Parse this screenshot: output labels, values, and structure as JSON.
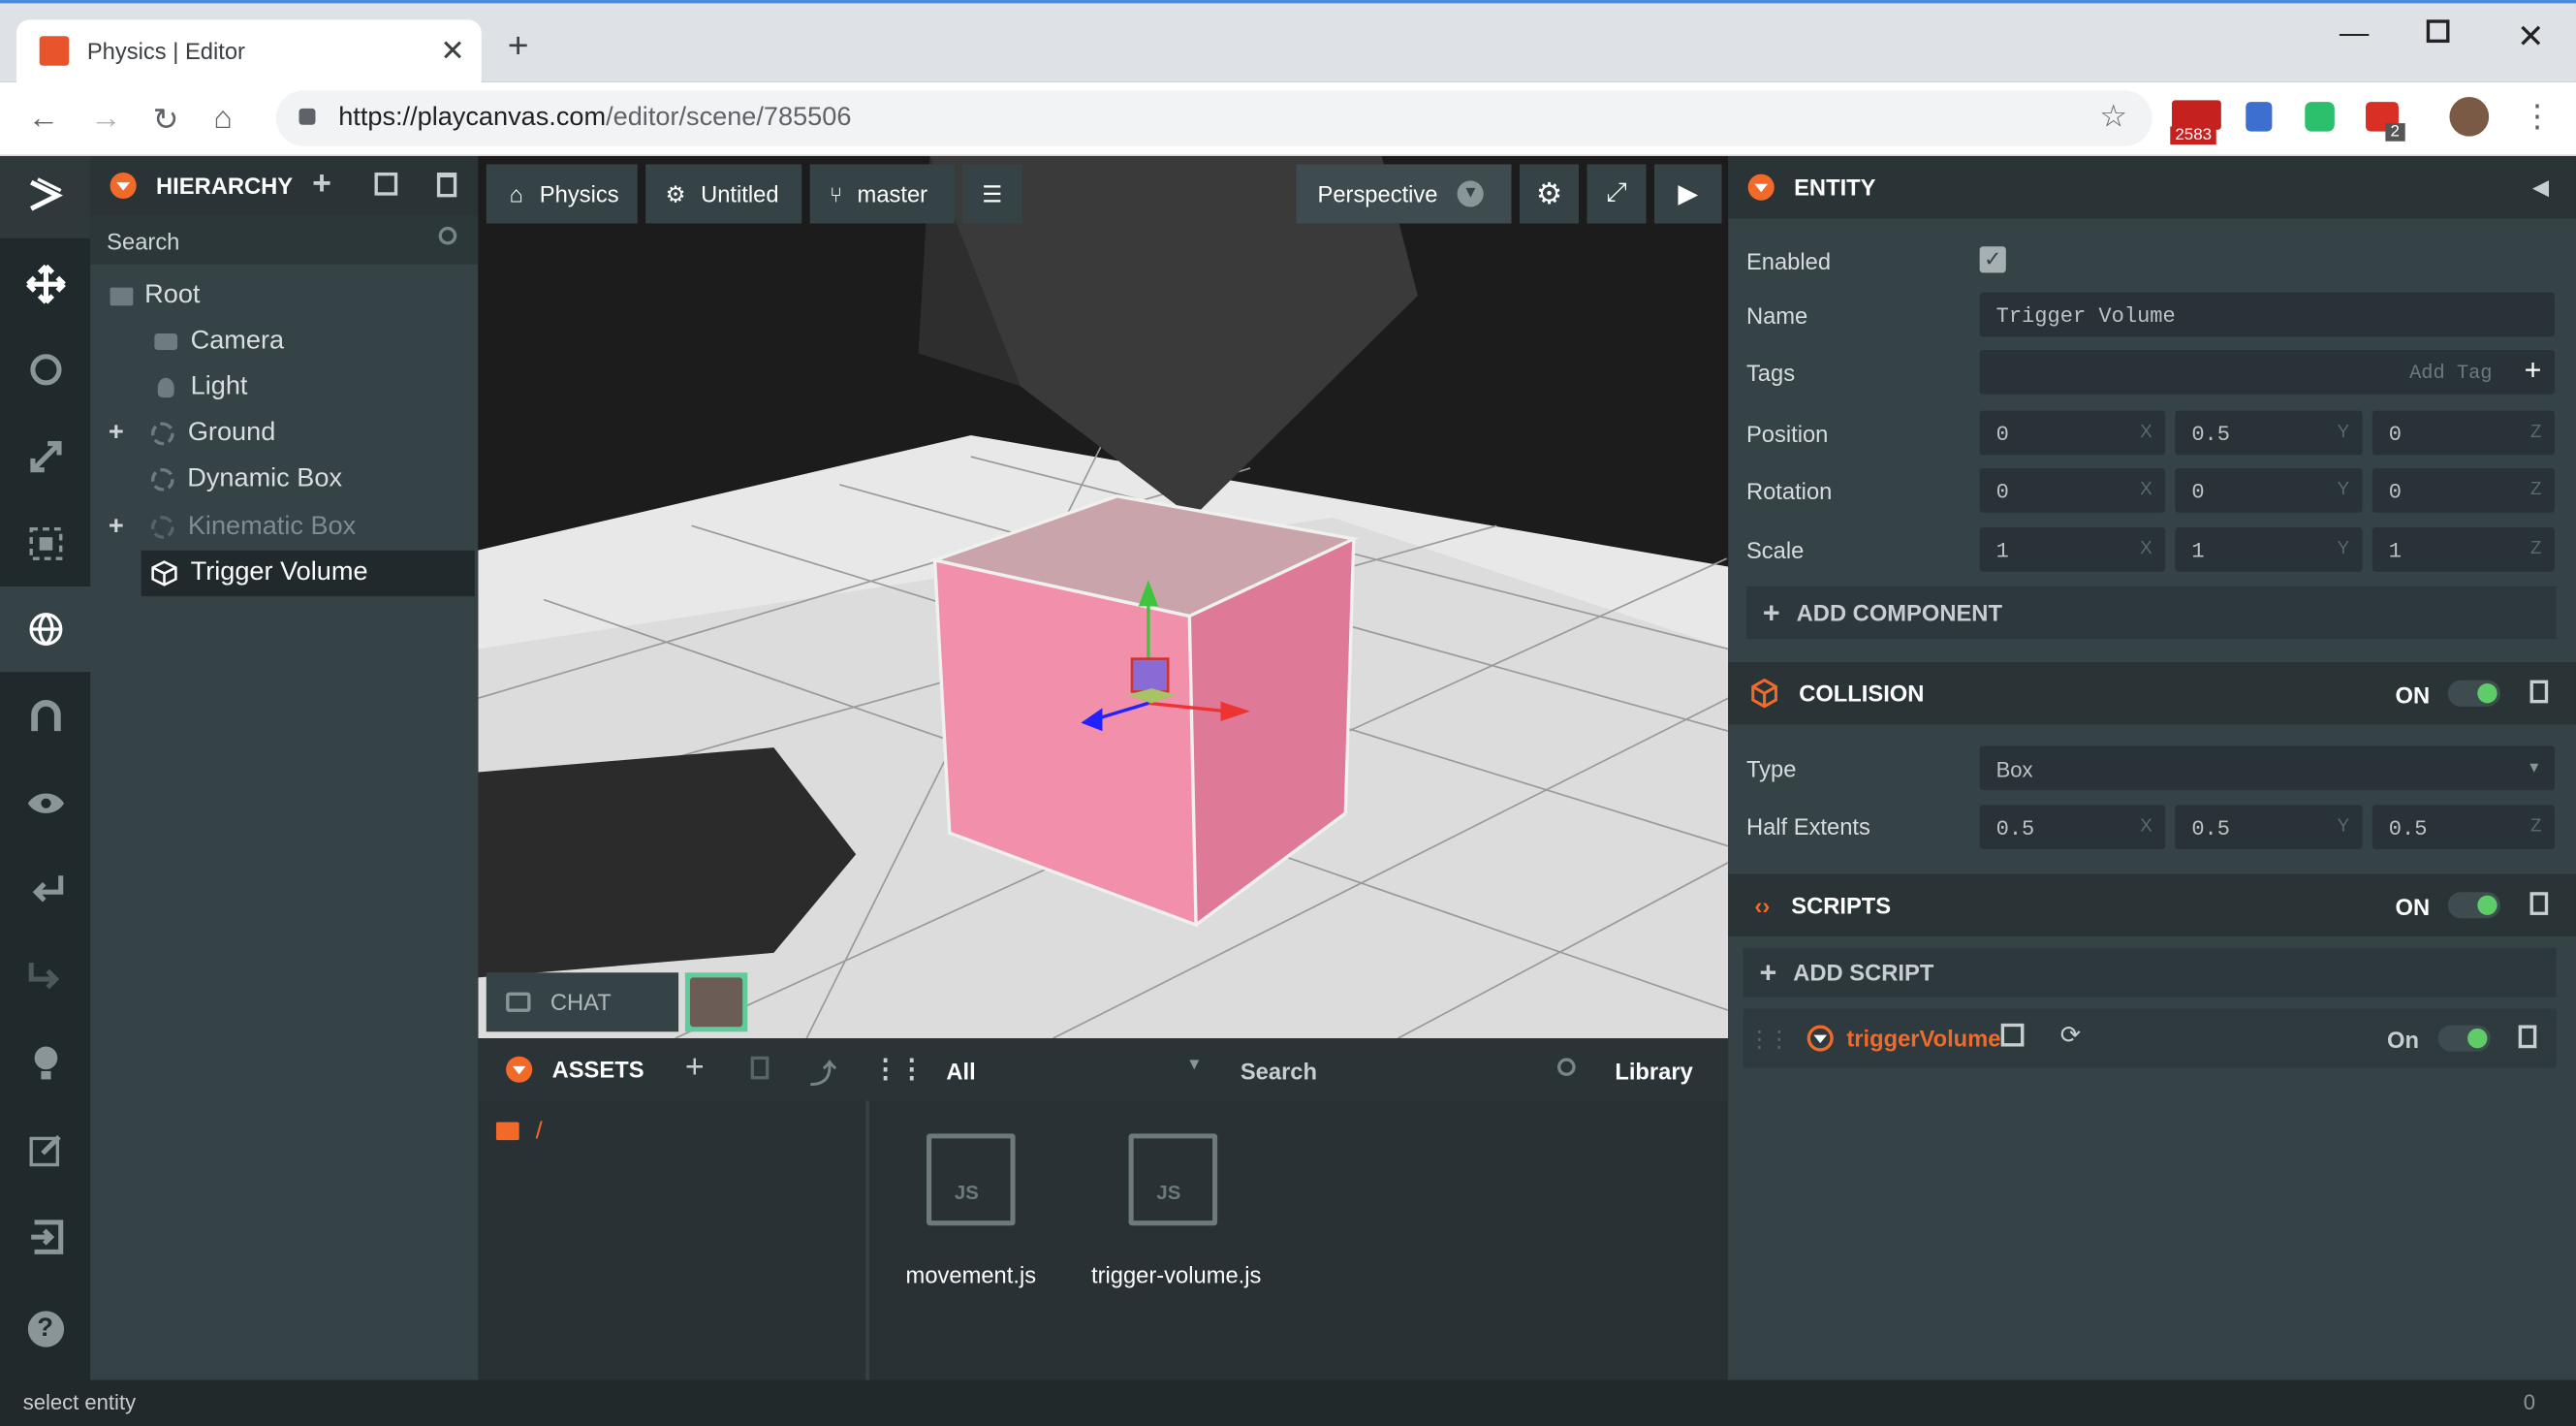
{
  "browser": {
    "tab_title": "Physics | Editor",
    "url_host": "https://playcanvas.com",
    "url_path": "/editor/scene/785506",
    "badge_mail": "2583",
    "badge_ext": "2"
  },
  "hierarchy": {
    "title": "HIERARCHY",
    "search_placeholder": "Search",
    "items": [
      {
        "label": "Root",
        "icon": "folder-icon"
      },
      {
        "label": "Camera",
        "icon": "camera-icon"
      },
      {
        "label": "Light",
        "icon": "light-icon"
      },
      {
        "label": "Ground",
        "icon": "entity-icon"
      },
      {
        "label": "Dynamic Box",
        "icon": "entity-icon"
      },
      {
        "label": "Kinematic Box",
        "icon": "entity-icon"
      },
      {
        "label": "Trigger Volume",
        "icon": "cube-icon"
      }
    ]
  },
  "viewport": {
    "project": "Physics",
    "scene": "Untitled",
    "branch": "master",
    "camera": "Perspective",
    "chat": "CHAT"
  },
  "assets": {
    "title": "ASSETS",
    "filter": "All",
    "search_placeholder": "Search",
    "library": "Library",
    "folder": "/",
    "files": [
      {
        "name": "movement.js",
        "ext": "JS"
      },
      {
        "name": "trigger-volume.js",
        "ext": "JS"
      }
    ]
  },
  "inspector": {
    "title": "ENTITY",
    "enabled_label": "Enabled",
    "name_label": "Name",
    "name_value": "Trigger Volume",
    "tags_label": "Tags",
    "tags_placeholder": "Add Tag",
    "position_label": "Position",
    "position": [
      "0",
      "0.5",
      "0"
    ],
    "rotation_label": "Rotation",
    "rotation": [
      "0",
      "0",
      "0"
    ],
    "scale_label": "Scale",
    "scale": [
      "1",
      "1",
      "1"
    ],
    "axes": [
      "X",
      "Y",
      "Z"
    ],
    "add_component": "ADD COMPONENT",
    "collision": {
      "title": "COLLISION",
      "state": "ON",
      "type_label": "Type",
      "type_value": "Box",
      "half_label": "Half Extents",
      "half": [
        "0.5",
        "0.5",
        "0.5"
      ]
    },
    "scripts": {
      "title": "SCRIPTS",
      "state": "ON",
      "add_script": "ADD SCRIPT",
      "script_name": "triggerVolume",
      "script_state": "On"
    }
  },
  "status": {
    "text": "select entity",
    "right": "0"
  },
  "colors": {
    "accent": "#f16a2a",
    "toggle_on": "#5fcc6a",
    "panel": "#364346"
  }
}
